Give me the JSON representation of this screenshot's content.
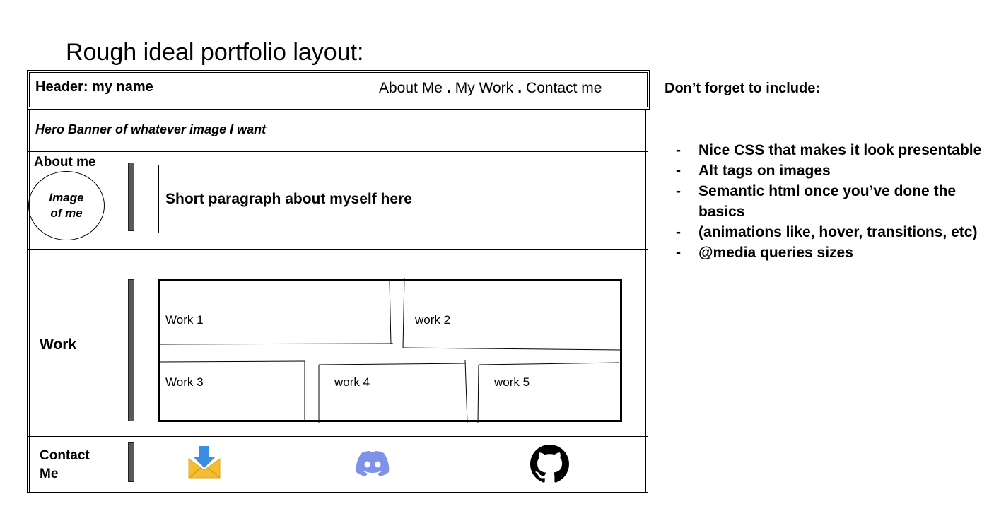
{
  "page_title": "Rough ideal portfolio layout:",
  "header": {
    "title": "Header: my name",
    "nav": [
      "About Me",
      "My Work",
      "Contact me"
    ],
    "separator": "."
  },
  "hero": {
    "text": "Hero Banner of whatever image I want"
  },
  "about": {
    "label": "About me",
    "image_line1": "Image",
    "image_line2": "of me",
    "paragraph": "Short paragraph about myself here"
  },
  "work": {
    "label": "Work",
    "items": [
      "Work 1",
      "work 2",
      "Work 3",
      "work 4",
      "work 5"
    ]
  },
  "contact": {
    "label_line1": "Contact",
    "label_line2": "Me",
    "icons": [
      "email-download-icon",
      "discord-icon",
      "github-icon"
    ],
    "colors": {
      "discord": "#7e92e9",
      "envelope": "#f5bd32",
      "arrow": "#3a8ee6",
      "github": "#000000"
    }
  },
  "checklist": {
    "title": "Don’t forget to include:",
    "items": [
      "Nice CSS that makes it look presentable",
      "Alt tags on images",
      "Semantic html once you’ve done the basics",
      "(animations like, hover, transitions, etc)",
      "@media queries sizes"
    ],
    "bullet": "-"
  }
}
